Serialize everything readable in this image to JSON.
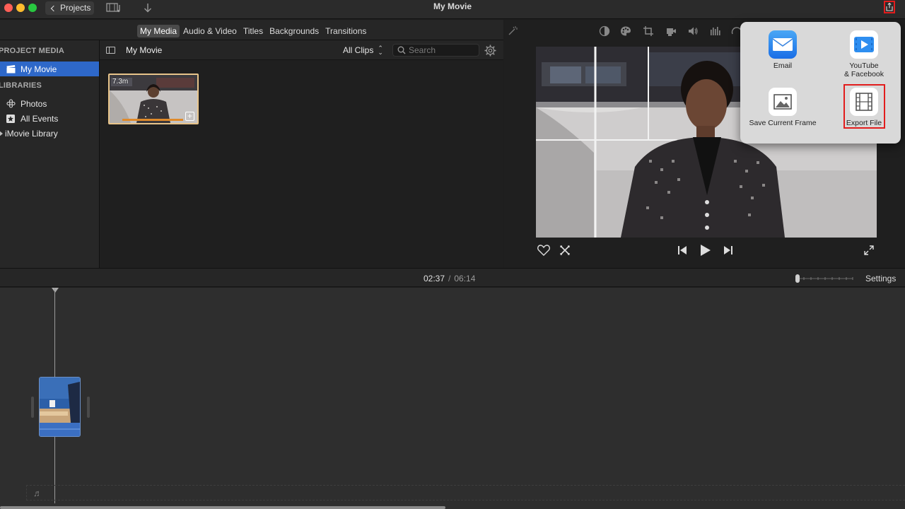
{
  "window": {
    "title": "My Movie"
  },
  "toolbar": {
    "projects_label": "Projects"
  },
  "browser": {
    "tabs": [
      {
        "label": "My Media",
        "active": true
      },
      {
        "label": "Audio & Video"
      },
      {
        "label": "Titles"
      },
      {
        "label": "Backgrounds"
      },
      {
        "label": "Transitions"
      }
    ],
    "content_title": "My Movie",
    "filter_label": "All Clips",
    "search_placeholder": "Search",
    "clip": {
      "duration": "7.3m"
    }
  },
  "sidebar": {
    "project_media_heading": "PROJECT MEDIA",
    "project_item": "My Movie",
    "libraries_heading": "LIBRARIES",
    "items": [
      {
        "label": "Photos",
        "icon": "flower-icon"
      },
      {
        "label": "All Events",
        "icon": "star-icon"
      },
      {
        "label": "iMovie Library",
        "icon": "disclosure-icon"
      }
    ]
  },
  "share_menu": {
    "items": [
      {
        "label": "Email",
        "icon": "mail-icon"
      },
      {
        "label_line1": "YouTube",
        "label_line2": "& Facebook",
        "icon": "play-icon"
      },
      {
        "label": "Save Current Frame",
        "icon": "photo-icon"
      },
      {
        "label": "Export File",
        "icon": "film-icon",
        "highlighted": true
      }
    ]
  },
  "timeline": {
    "current_time": "02:37",
    "separator": "/",
    "total_time": "06:14",
    "settings_label": "Settings"
  },
  "colors": {
    "selection_blue": "#2e68c9",
    "highlight_red": "#e21d1d",
    "clip_border": "#e8c48a"
  }
}
